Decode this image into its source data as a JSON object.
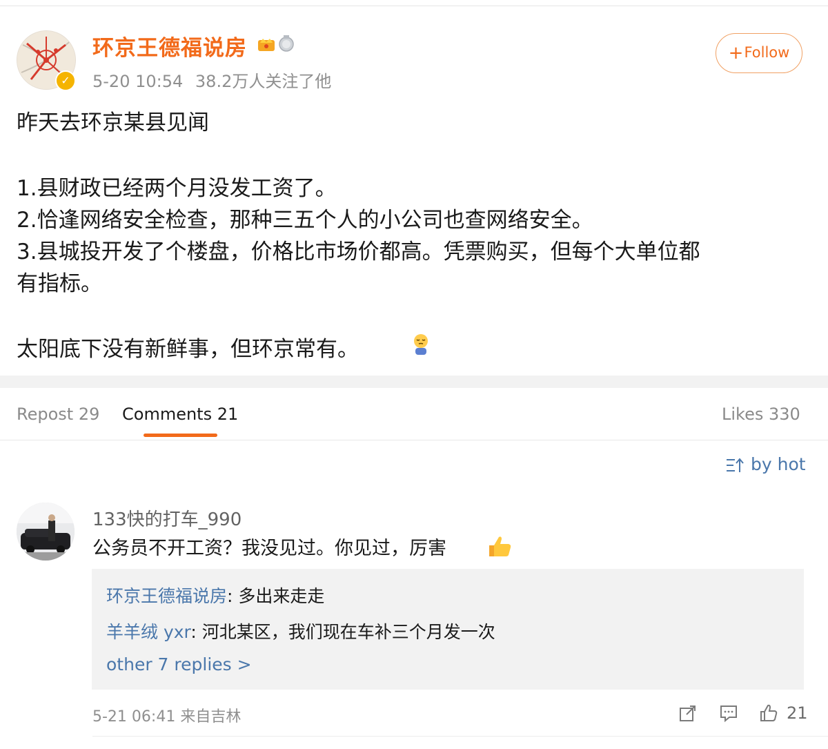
{
  "post": {
    "author": "环京王德福说房",
    "timestamp": "5-20 10:54",
    "followers": "38.2万人关注了他",
    "follow_label": "Follow",
    "lines": [
      "昨天去环京某县见闻",
      "1.县财政已经两个月没发工资了。",
      "2.恰逢网络安全检查，那种三五个人的小公司也查网络安全。",
      "3.县城投开发了个楼盘，价格比市场价都高。凭票购买，但每个大单位都",
      "有指标。",
      "太阳底下没有新鲜事，但环京常有。"
    ],
    "emoji_icon": "sleepy-face-emoji"
  },
  "tabs": {
    "repost": "Repost 29",
    "comments": "Comments 21",
    "likes": "Likes 330"
  },
  "sort": {
    "label": "by hot"
  },
  "comment": {
    "user": "133快的打车_990",
    "text": "公务员不开工资？我没见过。你见过，厉害",
    "replies": [
      {
        "user": "环京王德福说房",
        "text": ": 多出来走走"
      },
      {
        "user": "羊羊绒 yxr",
        "text": ": 河北某区，我们现在车补三个月发一次"
      }
    ],
    "more_replies": "other 7 replies >",
    "meta": "5-21 06:41 来自吉林",
    "likes": "21"
  },
  "colors": {
    "accent": "#f26a1a",
    "link": "#4a77ab",
    "muted": "#8f8f8f"
  }
}
